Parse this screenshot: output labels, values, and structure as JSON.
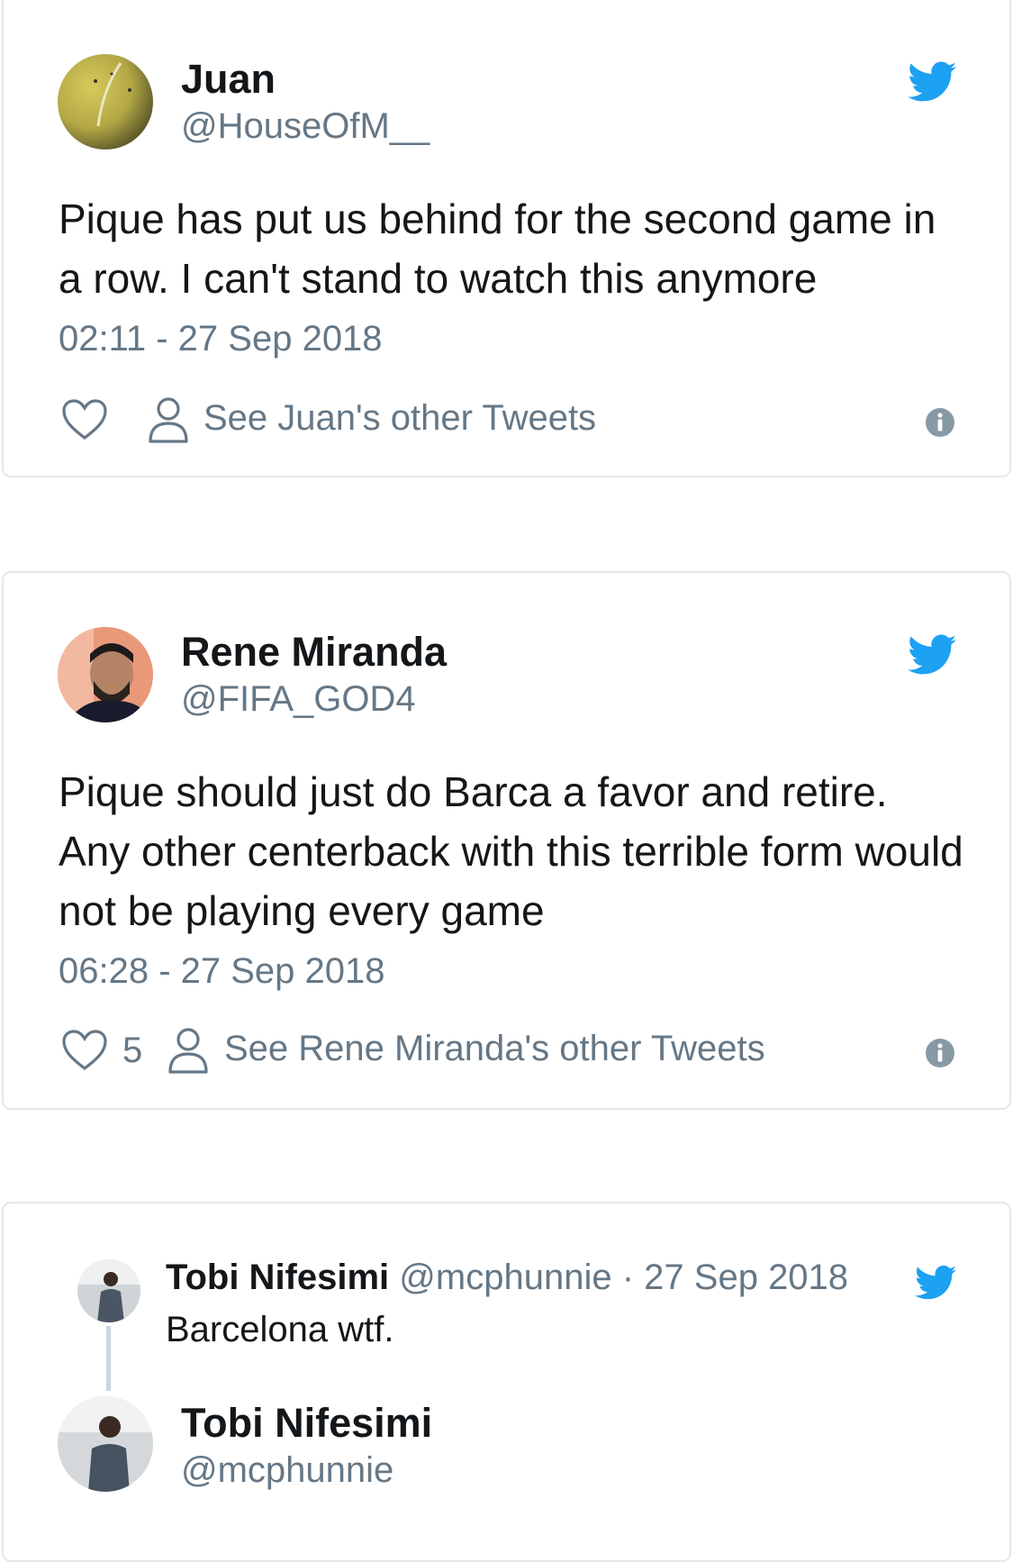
{
  "colors": {
    "twitter_blue": "#1da1f2",
    "secondary_text": "#657786",
    "primary_text": "#14171a",
    "border": "#e1e8ed"
  },
  "tweets": [
    {
      "name": "Juan",
      "handle": "@HouseOfM__",
      "text": "Pique has put us behind for the second game in a row. I can't stand to watch this anymore",
      "timestamp": "02:11 - 27 Sep 2018",
      "like_count": "",
      "see_other": "See Juan's other Tweets",
      "icons": [
        "heart-icon",
        "person-icon",
        "info-icon",
        "twitter-bird-icon"
      ]
    },
    {
      "name": "Rene Miranda",
      "handle": "@FIFA_GOD4",
      "text": "Pique should just do Barca a favor and retire. Any other centerback with this terrible form would not be playing every game",
      "timestamp": "06:28 - 27 Sep 2018",
      "like_count": "5",
      "see_other": "See Rene Miranda's other Tweets",
      "icons": [
        "heart-icon",
        "person-icon",
        "info-icon",
        "twitter-bird-icon"
      ]
    },
    {
      "quoted": {
        "name": "Tobi Nifesimi",
        "handle": "@mcphunnie",
        "separator": "·",
        "date": "27 Sep 2018",
        "text": "Barcelona wtf."
      },
      "name": "Tobi Nifesimi",
      "handle": "@mcphunnie",
      "icons": [
        "twitter-bird-icon"
      ]
    }
  ]
}
